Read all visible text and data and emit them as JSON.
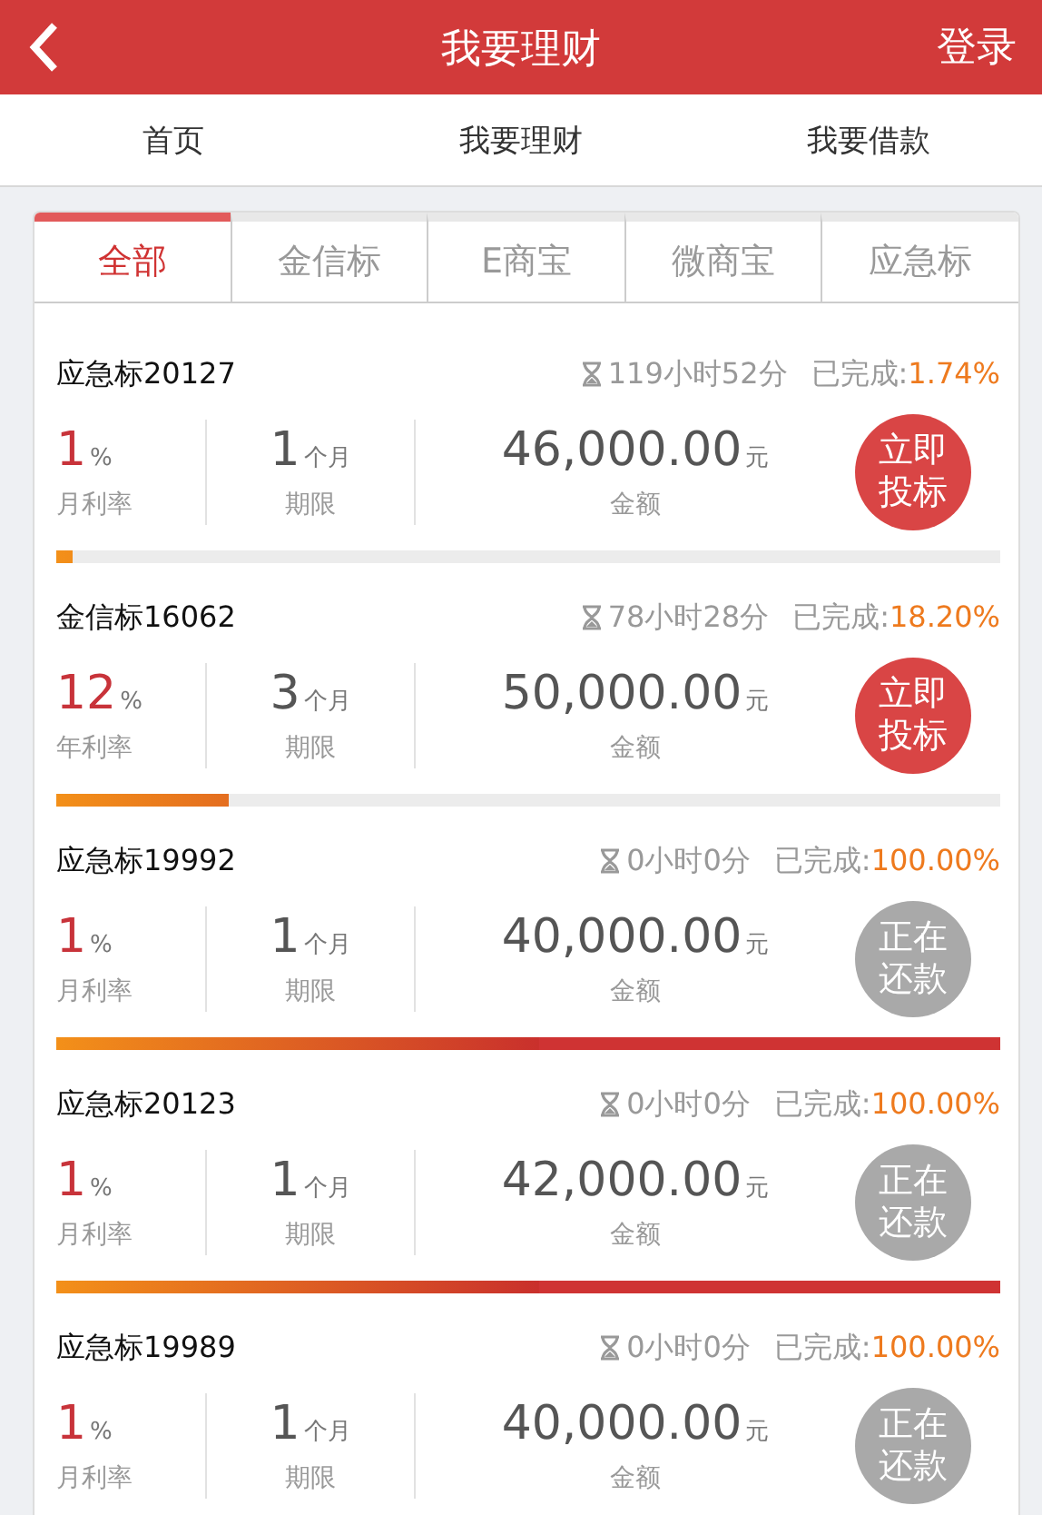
{
  "header": {
    "title": "我要理财",
    "login": "登录"
  },
  "nav": [
    {
      "label": "首页"
    },
    {
      "label": "我要理财"
    },
    {
      "label": "我要借款"
    }
  ],
  "tabs": [
    {
      "label": "全部",
      "selected": true
    },
    {
      "label": "金信标",
      "selected": false
    },
    {
      "label": "E商宝",
      "selected": false
    },
    {
      "label": "微商宝",
      "selected": false
    },
    {
      "label": "应急标",
      "selected": false
    }
  ],
  "items": [
    {
      "name": "应急标20127",
      "time": "119小时52分",
      "done_label": "已完成:",
      "done": "1.74%",
      "rate": "1",
      "rate_unit": "%",
      "rate_label": "月利率",
      "term": "1",
      "term_unit": "个月",
      "term_label": "期限",
      "amount": "46,000.00",
      "amount_unit": "元",
      "amount_label": "金额",
      "action": "立即投标",
      "kind": "open",
      "level": 0.0174
    },
    {
      "name": "金信标16062",
      "time": "78小时28分",
      "done_label": "已完成:",
      "done": "18.20%",
      "rate": "12",
      "rate_unit": "%",
      "rate_label": "年利率",
      "term": "3",
      "term_unit": "个月",
      "term_label": "期限",
      "amount": "50,000.00",
      "amount_unit": "元",
      "amount_label": "金额",
      "action": "立即投标",
      "kind": "open",
      "level": 0.182
    },
    {
      "name": "应急标19992",
      "time": "0小时0分",
      "done_label": "已完成:",
      "done": "100.00%",
      "rate": "1",
      "rate_unit": "%",
      "rate_label": "月利率",
      "term": "1",
      "term_unit": "个月",
      "term_label": "期限",
      "amount": "40,000.00",
      "amount_unit": "元",
      "amount_label": "金额",
      "action": "正在还款",
      "kind": "repaying",
      "level": 1
    },
    {
      "name": "应急标20123",
      "time": "0小时0分",
      "done_label": "已完成:",
      "done": "100.00%",
      "rate": "1",
      "rate_unit": "%",
      "rate_label": "月利率",
      "term": "1",
      "term_unit": "个月",
      "term_label": "期限",
      "amount": "42,000.00",
      "amount_unit": "元",
      "amount_label": "金额",
      "action": "正在还款",
      "kind": "repaying",
      "level": 1
    },
    {
      "name": "应急标19989",
      "time": "0小时0分",
      "done_label": "已完成:",
      "done": "100.00%",
      "rate": "1",
      "rate_unit": "%",
      "rate_label": "月利率",
      "term": "1",
      "term_unit": "个月",
      "term_label": "期限",
      "amount": "40,000.00",
      "amount_unit": "元",
      "amount_label": "金额",
      "action": "正在还款",
      "kind": "repaying"
    }
  ]
}
